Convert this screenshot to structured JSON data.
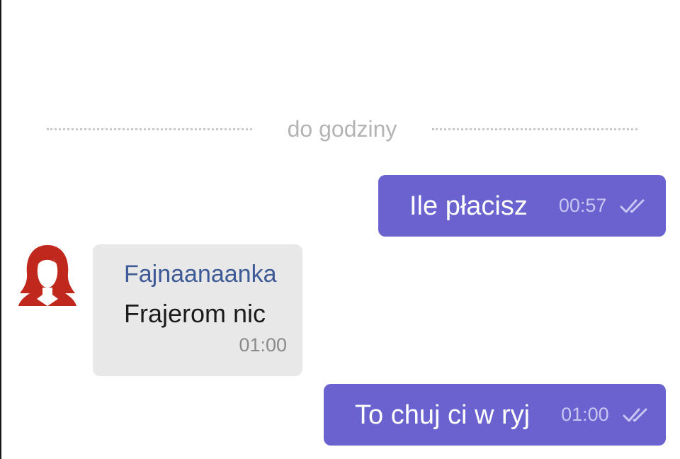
{
  "chat": {
    "date_divider": "do godziny",
    "messages": [
      {
        "direction": "outgoing",
        "text": "Ile płacisz",
        "time": "00:57",
        "status_icon": "double-check-icon"
      },
      {
        "direction": "incoming",
        "sender": "Fajnaanaanka",
        "text": "Frajerom nic",
        "time": "01:00",
        "avatar_icon": "red-hair-woman-avatar"
      },
      {
        "direction": "outgoing",
        "text": "To chuj ci w ryj",
        "time": "01:00",
        "status_icon": "double-check-icon"
      }
    ]
  },
  "colors": {
    "outgoing_bubble": "#6962cf",
    "incoming_bubble": "#e8e8e8",
    "sender_name": "#3d5a96",
    "avatar": "#c0281d"
  }
}
